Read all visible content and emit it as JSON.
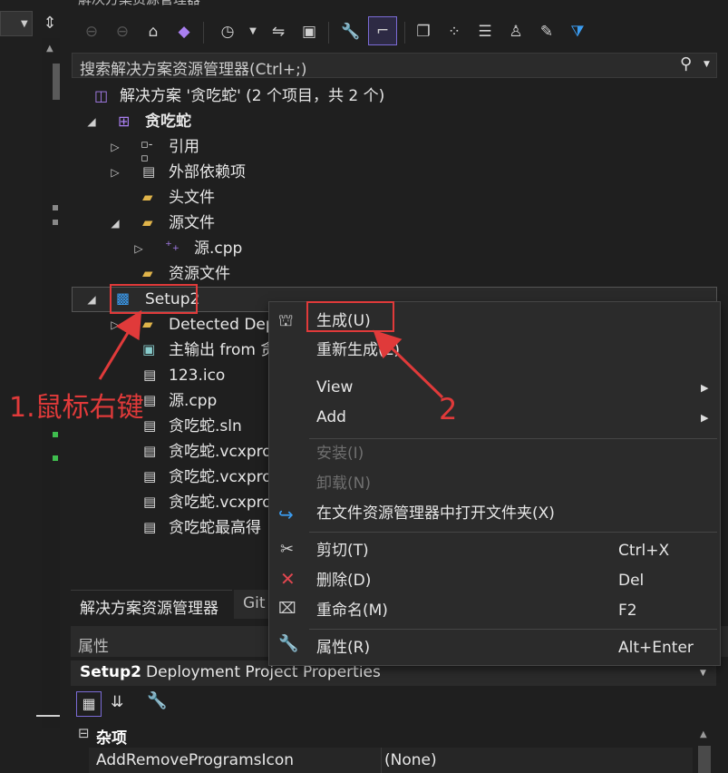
{
  "window": {
    "title": "解决方案资源管理器"
  },
  "search": {
    "placeholder": "搜索解决方案资源管理器(Ctrl+;)"
  },
  "tree": {
    "solution": "解决方案 '贪吃蛇' (2 个项目，共 2 个)",
    "project": "贪吃蛇",
    "references": "引用",
    "external_deps": "外部依赖项",
    "header_files": "头文件",
    "source_files": "源文件",
    "source_cpp": "源.cpp",
    "resource_files": "资源文件",
    "setup": "Setup2",
    "detected_deps": "Detected Dep",
    "primary_output": "主输出 from 贪",
    "ico": "123.ico",
    "setup_cpp": "源.cpp",
    "sln": "贪吃蛇.sln",
    "vcx1": "贪吃蛇.vcxpro",
    "vcx2": "贪吃蛇.vcxpro",
    "vcx3": "贪吃蛇.vcxpro",
    "highscore": "贪吃蛇最高得"
  },
  "tabs": {
    "solution_explorer": "解决方案资源管理器",
    "git": "Git"
  },
  "properties": {
    "title": "属性",
    "object_name": "Setup2",
    "object_type": "Deployment Project Properties",
    "category": "杂项",
    "row_name": "AddRemoveProgramsIcon",
    "row_value": "(None)"
  },
  "context_menu": {
    "build": "生成(U)",
    "rebuild": "重新生成(E)",
    "view": "View",
    "add": "Add",
    "install": "安装(I)",
    "uninstall": "卸载(N)",
    "open_folder": "在文件资源管理器中打开文件夹(X)",
    "cut": "剪切(T)",
    "cut_shortcut": "Ctrl+X",
    "delete": "删除(D)",
    "delete_shortcut": "Del",
    "rename": "重命名(M)",
    "rename_shortcut": "F2",
    "props": "属性(R)",
    "props_shortcut": "Alt+Enter"
  },
  "annotations": {
    "step1": "1.鼠标右键",
    "step2": "2"
  },
  "colors": {
    "accent": "#a97ff0",
    "annotation": "#e03a3a",
    "background": "#1f1f1f",
    "menu": "#2b2b2b"
  }
}
